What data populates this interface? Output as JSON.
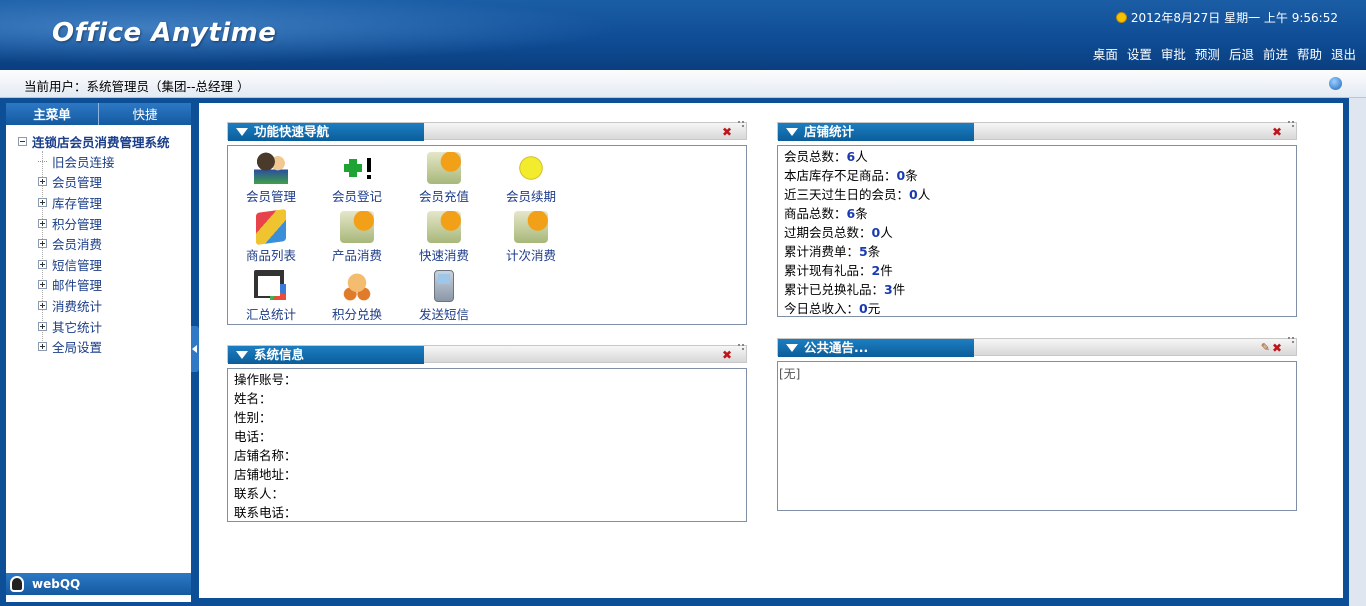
{
  "header": {
    "logo": "Office Anytime",
    "clock": "2012年8月27日 星期一 上午 9:56:52",
    "nav": [
      "桌面",
      "设置",
      "审批",
      "预测",
      "后退",
      "前进",
      "帮助",
      "退出"
    ]
  },
  "userbar": {
    "current_user": "当前用户：系统管理员（集团--总经理 ）"
  },
  "sidebar": {
    "tabs": [
      "主菜单",
      "快捷"
    ],
    "root": "连锁店会员消费管理系统",
    "items": [
      "旧会员连接",
      "会员管理",
      "库存管理",
      "积分管理",
      "会员消费",
      "短信管理",
      "邮件管理",
      "消费统计",
      "其它统计",
      "全局设置"
    ],
    "footer": "webQQ"
  },
  "panels": {
    "nav": {
      "title": "功能快速导航",
      "items": [
        {
          "label": "会员管理",
          "icon": "people-icon"
        },
        {
          "label": "会员登记",
          "icon": "add-icon"
        },
        {
          "label": "会员充值",
          "icon": "puzzle-icon"
        },
        {
          "label": "会员续期",
          "icon": "clock-icon"
        },
        {
          "label": "商品列表",
          "icon": "cube-icon"
        },
        {
          "label": "产品消费",
          "icon": "puzzle-icon"
        },
        {
          "label": "快速消费",
          "icon": "puzzle-icon"
        },
        {
          "label": "计次消费",
          "icon": "puzzle-icon"
        },
        {
          "label": "汇总统计",
          "icon": "chart-icon"
        },
        {
          "label": "积分兑换",
          "icon": "hand-icon"
        },
        {
          "label": "发送短信",
          "icon": "phone-icon"
        }
      ]
    },
    "store": {
      "title": "店铺统计",
      "rows": [
        {
          "label": "会员总数：",
          "value": "6",
          "unit": "人"
        },
        {
          "label": "本店库存不足商品：",
          "value": "0",
          "unit": "条"
        },
        {
          "label": "近三天过生日的会员：",
          "value": "0",
          "unit": "人"
        },
        {
          "label": "商品总数：",
          "value": "6",
          "unit": "条"
        },
        {
          "label": "过期会员总数：",
          "value": "0",
          "unit": "人"
        },
        {
          "label": "累计消费单：",
          "value": "5",
          "unit": "条"
        },
        {
          "label": "累计现有礼品：",
          "value": "2",
          "unit": "件"
        },
        {
          "label": "累计已兑换礼品：",
          "value": "3",
          "unit": "件"
        },
        {
          "label": "今日总收入：",
          "value": "0",
          "unit": "元"
        }
      ]
    },
    "system": {
      "title": "系统信息",
      "rows": [
        "操作账号：",
        "姓名：",
        "性别：",
        "电话：",
        "店铺名称：",
        "店铺地址：",
        "联系人：",
        "联系电话："
      ]
    },
    "notice": {
      "title": "公共通告...",
      "body": "[无]"
    }
  },
  "colors": {
    "header": "#0f4d96",
    "accent": "#1c7ec1",
    "link": "#1a3d88",
    "value": "#1a3bb0",
    "close": "#c0141b"
  }
}
